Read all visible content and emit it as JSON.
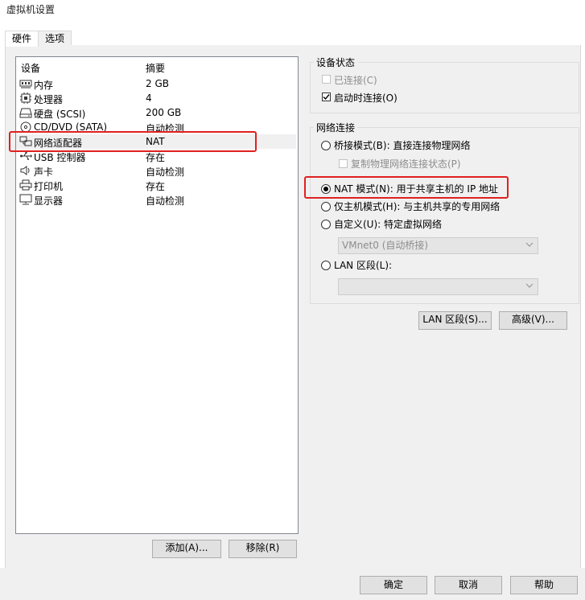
{
  "window": {
    "title": "虚拟机设置"
  },
  "tabs": [
    {
      "label": "硬件"
    },
    {
      "label": "选项"
    }
  ],
  "device_list": {
    "header_device": "设备",
    "header_summary": "摘要",
    "rows": [
      {
        "name": "内存",
        "summary": "2 GB",
        "icon": "memory-icon"
      },
      {
        "name": "处理器",
        "summary": "4",
        "icon": "cpu-icon"
      },
      {
        "name": "硬盘 (SCSI)",
        "summary": "200 GB",
        "icon": "hard-disk-icon"
      },
      {
        "name": "CD/DVD (SATA)",
        "summary": "自动检测",
        "icon": "cd-dvd-icon"
      },
      {
        "name": "网络适配器",
        "summary": "NAT",
        "icon": "network-adapter-icon"
      },
      {
        "name": "USB 控制器",
        "summary": "存在",
        "icon": "usb-icon"
      },
      {
        "name": "声卡",
        "summary": "自动检测",
        "icon": "speaker-icon"
      },
      {
        "name": "打印机",
        "summary": "存在",
        "icon": "printer-icon"
      },
      {
        "name": "显示器",
        "summary": "自动检测",
        "icon": "monitor-icon"
      }
    ],
    "selected_index": 4
  },
  "list_buttons": {
    "add": "添加(A)...",
    "remove": "移除(R)"
  },
  "device_status": {
    "group_label": "设备状态",
    "connected": {
      "label": "已连接(C)",
      "checked": false,
      "disabled": true
    },
    "connect_at_power_on": {
      "label": "启动时连接(O)",
      "checked": true,
      "disabled": false
    }
  },
  "network_connection": {
    "group_label": "网络连接",
    "bridged": "桥接模式(B): 直接连接物理网络",
    "replicate": "复制物理网络连接状态(P)",
    "nat": "NAT 模式(N): 用于共享主机的 IP 地址",
    "host_only": "仅主机模式(H): 与主机共享的专用网络",
    "custom": "自定义(U): 特定虚拟网络",
    "custom_combo_value": "VMnet0 (自动桥接)",
    "lan_segment": "LAN 区段(L):",
    "lan_combo_value": "",
    "selected": "nat"
  },
  "right_buttons": {
    "lan_segments": "LAN 区段(S)...",
    "advanced": "高级(V)..."
  },
  "dialog_buttons": {
    "ok": "确定",
    "cancel": "取消",
    "help": "帮助"
  },
  "colors": {
    "highlight_red": "#e02020"
  }
}
